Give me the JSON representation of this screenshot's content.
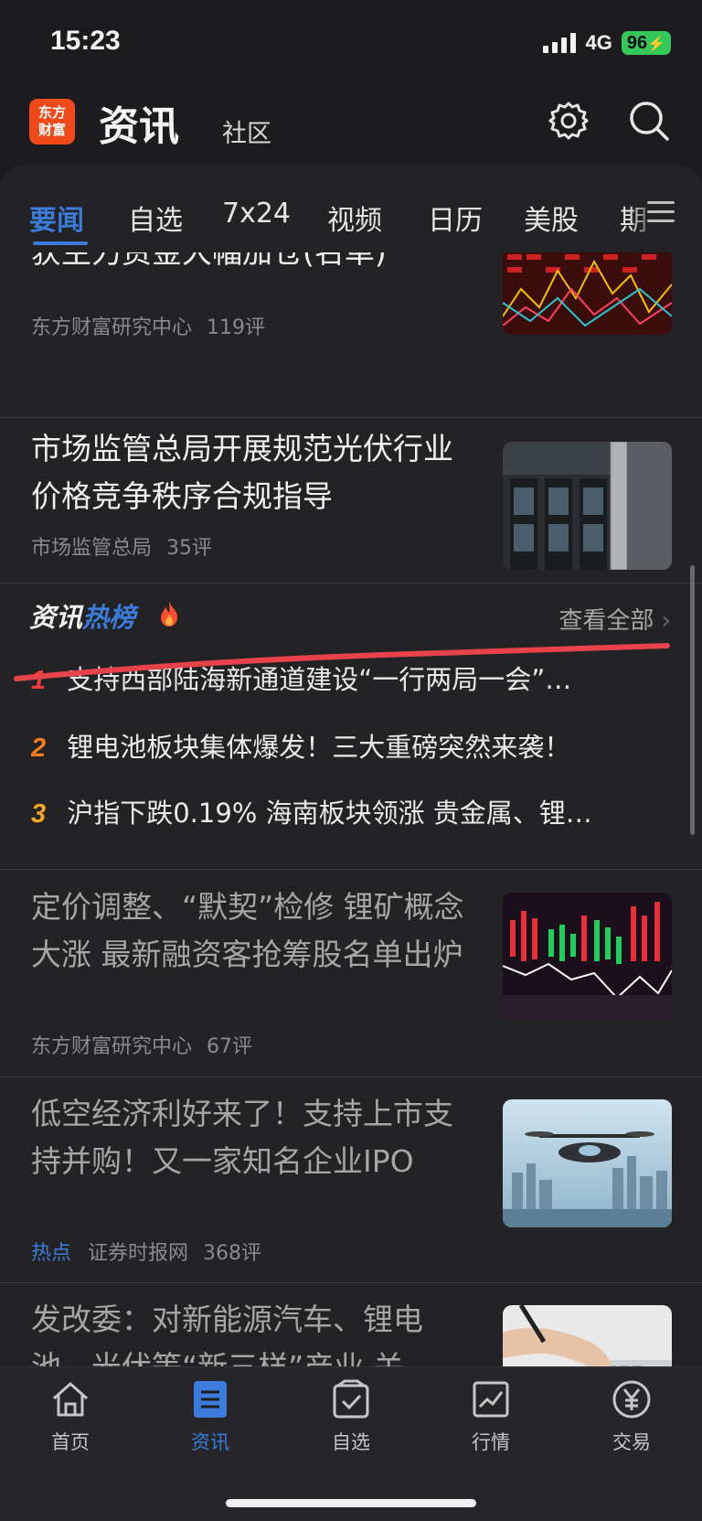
{
  "status_bar": {
    "time": "15:23",
    "network": "4G",
    "battery": "96"
  },
  "header": {
    "logo_text": "东方\n财富",
    "title": "资讯",
    "community": "社区",
    "settings_icon": "gear-icon",
    "search_icon": "search-icon"
  },
  "tabs": [
    "要闻",
    "自选",
    "7x24",
    "视频",
    "日历",
    "美股",
    "期"
  ],
  "articles": [
    {
      "title": "获主力资金大幅加仓(名单)",
      "source": "东方财富研究中心",
      "comments": "119评"
    },
    {
      "title": "市场监管总局开展规范光伏行业价格竞争秩序合规指导",
      "source": "市场监管总局",
      "comments": "35评"
    }
  ],
  "hot_list": {
    "title_a": "资讯",
    "title_b": "热榜",
    "view_all": "查看全部",
    "items": [
      {
        "rank": "1",
        "text": "支持西部陆海新通道建设“一行两局一会”…"
      },
      {
        "rank": "2",
        "text": "锂电池板块集体爆发！三大重磅突然来袭！"
      },
      {
        "rank": "3",
        "text": "沪指下跌0.19% 海南板块领涨 贵金属、锂…"
      }
    ]
  },
  "articles2": [
    {
      "title": "定价调整、“默契”检修 锂矿概念大涨 最新融资客抢筹股名单出炉",
      "source": "东方财富研究中心",
      "comments": "67评"
    },
    {
      "title": "低空经济利好来了！支持上市支持并购！又一家知名企业IPO",
      "tag": "热点",
      "source": "证券时报网",
      "comments": "368评"
    },
    {
      "title": "发改委：对新能源汽车、锂电池、光伏等“新三样”产业 关"
    }
  ],
  "bottom_nav": [
    {
      "label": "首页",
      "icon": "home-icon"
    },
    {
      "label": "资讯",
      "icon": "news-icon"
    },
    {
      "label": "自选",
      "icon": "watchlist-icon"
    },
    {
      "label": "行情",
      "icon": "chart-icon"
    },
    {
      "label": "交易",
      "icon": "yuan-icon"
    }
  ],
  "colors": {
    "accent": "#3b7bd9",
    "rank1": "#f23a3a",
    "rank2": "#ff7a1a",
    "rank3": "#f5a623",
    "annotation": "#e8434b"
  }
}
